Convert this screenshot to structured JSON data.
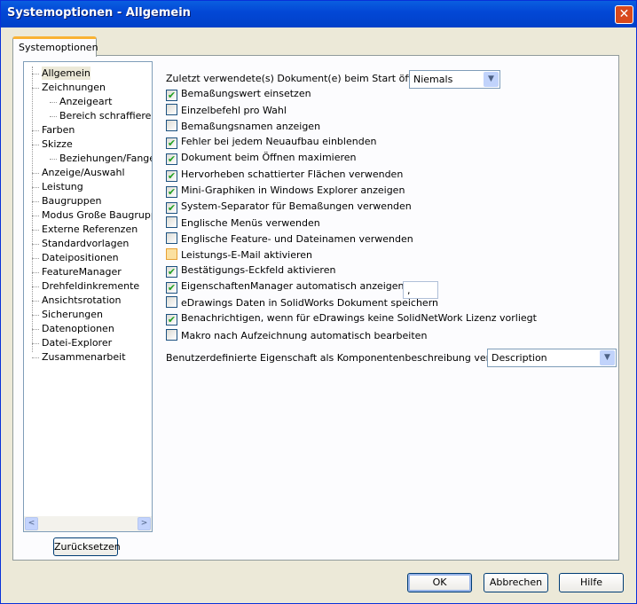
{
  "window": {
    "title": "Systemoptionen - Allgemein",
    "close_icon": "close-icon"
  },
  "tab": "Systemoptionen",
  "tree": {
    "items": [
      {
        "label": "Allgemein",
        "level": 0,
        "selected": true
      },
      {
        "label": "Zeichnungen",
        "level": 0
      },
      {
        "label": "Anzeigeart",
        "level": 1
      },
      {
        "label": "Bereich schraffieren/",
        "level": 1
      },
      {
        "label": "Farben",
        "level": 0
      },
      {
        "label": "Skizze",
        "level": 0
      },
      {
        "label": "Beziehungen/Fangen",
        "level": 1
      },
      {
        "label": "Anzeige/Auswahl",
        "level": 0
      },
      {
        "label": "Leistung",
        "level": 0
      },
      {
        "label": "Baugruppen",
        "level": 0
      },
      {
        "label": "Modus Große Baugruppe",
        "level": 0
      },
      {
        "label": "Externe Referenzen",
        "level": 0
      },
      {
        "label": "Standardvorlagen",
        "level": 0
      },
      {
        "label": "Dateipositionen",
        "level": 0
      },
      {
        "label": "FeatureManager",
        "level": 0
      },
      {
        "label": "Drehfeldinkremente",
        "level": 0
      },
      {
        "label": "Ansichtsrotation",
        "level": 0
      },
      {
        "label": "Sicherungen",
        "level": 0
      },
      {
        "label": "Datenoptionen",
        "level": 0
      },
      {
        "label": "Datei-Explorer",
        "level": 0
      },
      {
        "label": "Zusammenarbeit",
        "level": 0
      }
    ],
    "reset_label": "Zurücksetzen"
  },
  "recent_docs": {
    "label": "Zuletzt verwendete(s) Dokument(e) beim Start öffnen:",
    "value": "Niemals"
  },
  "options": [
    {
      "label": "Bemaßungswert einsetzen",
      "checked": true
    },
    {
      "label": "Einzelbefehl pro Wahl",
      "checked": false
    },
    {
      "label": "Bemaßungsnamen anzeigen",
      "checked": false
    },
    {
      "label": "Fehler bei jedem Neuaufbau einblenden",
      "checked": true
    },
    {
      "label": "Dokument beim Öffnen maximieren",
      "checked": true
    },
    {
      "label": "Hervorheben schattierter Flächen verwenden",
      "checked": true
    },
    {
      "label": "Mini-Graphiken in Windows Explorer anzeigen",
      "checked": true
    },
    {
      "label": "System-Separator für Bemaßungen verwenden",
      "checked": true,
      "separator_value": ","
    },
    {
      "label": "Englische Menüs verwenden",
      "checked": false
    },
    {
      "label": "Englische Feature- und Dateinamen verwenden",
      "checked": false
    },
    {
      "label": "Leistungs-E-Mail aktivieren",
      "checked": false,
      "hover": true
    },
    {
      "label": "Bestätigungs-Eckfeld aktivieren",
      "checked": true
    },
    {
      "label": "EigenschaftenManager automatisch anzeigen",
      "checked": true
    },
    {
      "label": "eDrawings Daten in SolidWorks Dokument speichern",
      "checked": false
    },
    {
      "label": "Benachrichtigen, wenn für eDrawings keine SolidNetWork Lizenz vorliegt",
      "checked": true
    },
    {
      "label": "Makro nach Aufzeichnung automatisch bearbeiten",
      "checked": false
    }
  ],
  "custom_property": {
    "label": "Benutzerdefinierte Eigenschaft als Komponentenbeschreibung verwendet:",
    "value": "Description"
  },
  "buttons": {
    "ok": "OK",
    "cancel": "Abbrechen",
    "help": "Hilfe"
  }
}
